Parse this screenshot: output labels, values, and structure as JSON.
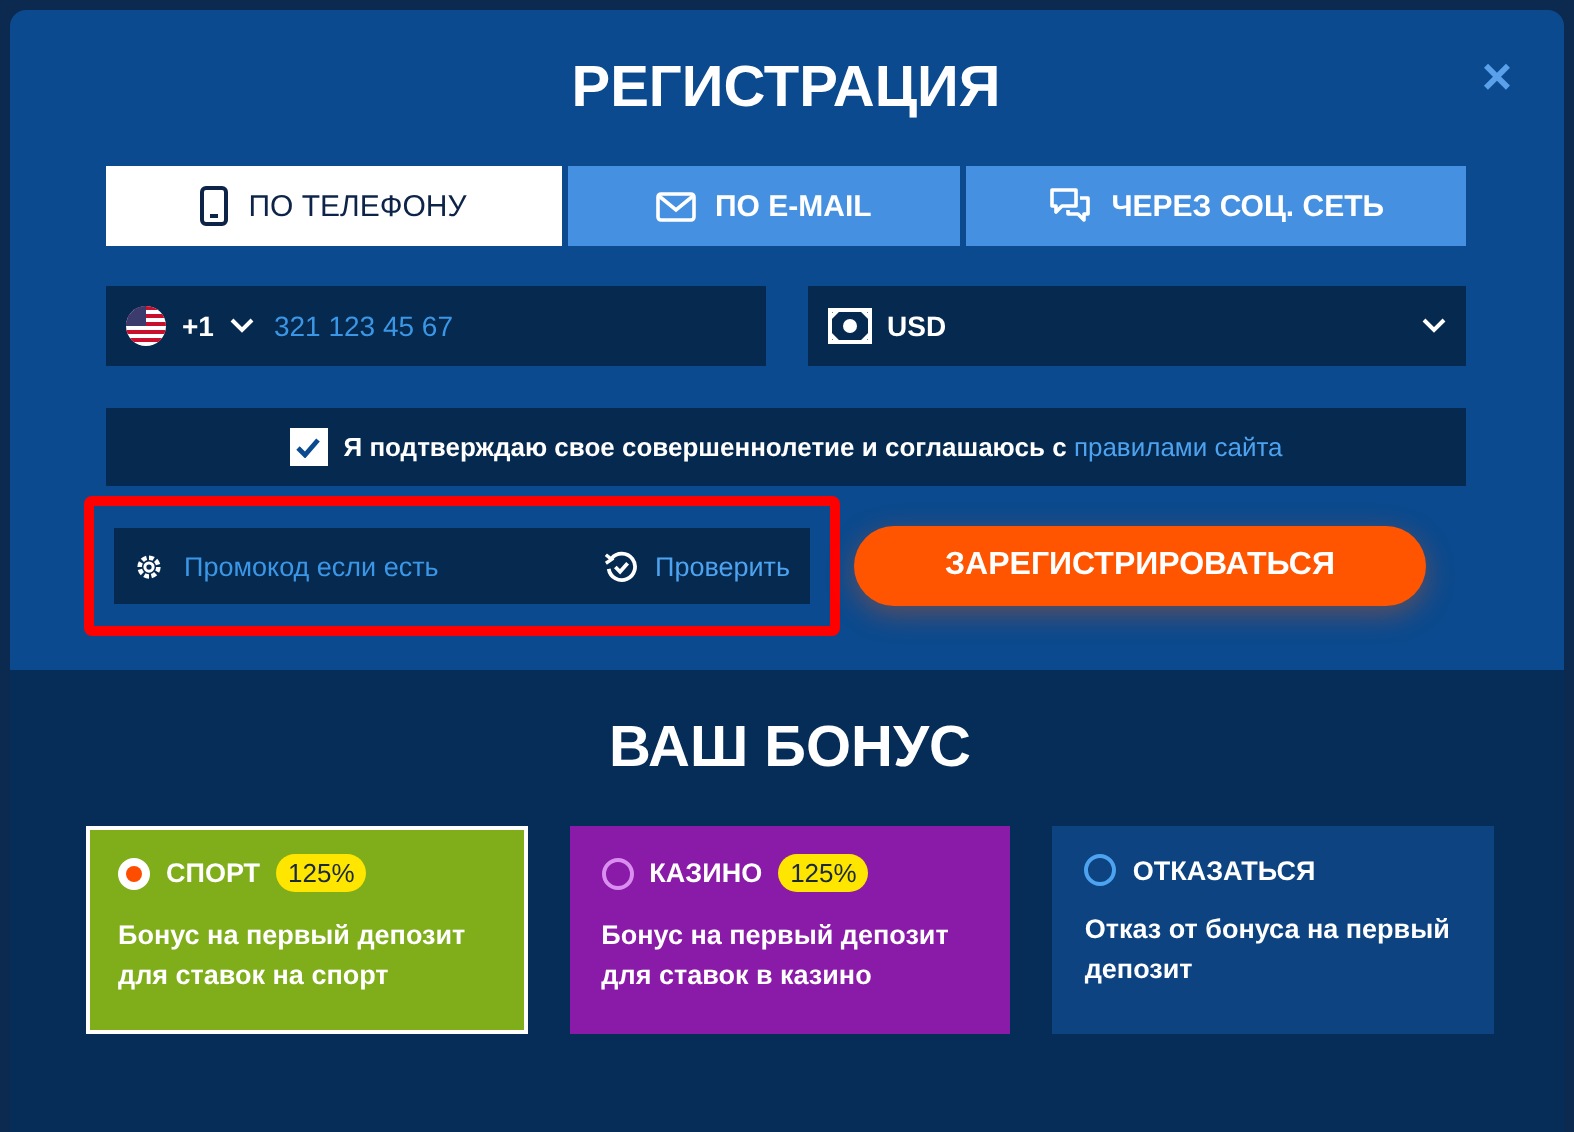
{
  "dialog": {
    "title": "РЕГИСТРАЦИЯ",
    "close": "×"
  },
  "tabs": [
    {
      "label": "ПО ТЕЛЕФОНУ",
      "kind": "phone",
      "selected": true
    },
    {
      "label": "ПО E-MAIL",
      "kind": "mail",
      "selected": false
    },
    {
      "label": "ЧЕРЕЗ СОЦ. СЕТЬ",
      "kind": "chat",
      "selected": false
    }
  ],
  "phone": {
    "code": "+1",
    "placeholder": "321 123 45 67"
  },
  "currency": {
    "value": "USD"
  },
  "agreement": {
    "checked": true,
    "text": "Я подтверждаю свое совершеннолетие и соглашаюсь с",
    "link": "правилами сайта"
  },
  "promo": {
    "placeholder": "Промокод если есть",
    "check": "Проверить",
    "highlighted": true
  },
  "register_button": "ЗАРЕГИСТРИРОВАТЬСЯ",
  "bonus": {
    "title": "ВАШ БОНУС",
    "options": [
      {
        "name": "СПОРТ",
        "badge": "125%",
        "description": "Бонус на первый депозит для ставок на спорт",
        "color": "#7fae1a",
        "selected": true
      },
      {
        "name": "КАЗИНО",
        "badge": "125%",
        "description": "Бонус на первый депозит для ставок в казино",
        "color": "#8a1aa8",
        "selected": false
      },
      {
        "name": "ОТКАЗАТЬСЯ",
        "description": "Отказ от бонуса на первый депозит",
        "color": "#0c4380",
        "selected": false
      }
    ]
  }
}
